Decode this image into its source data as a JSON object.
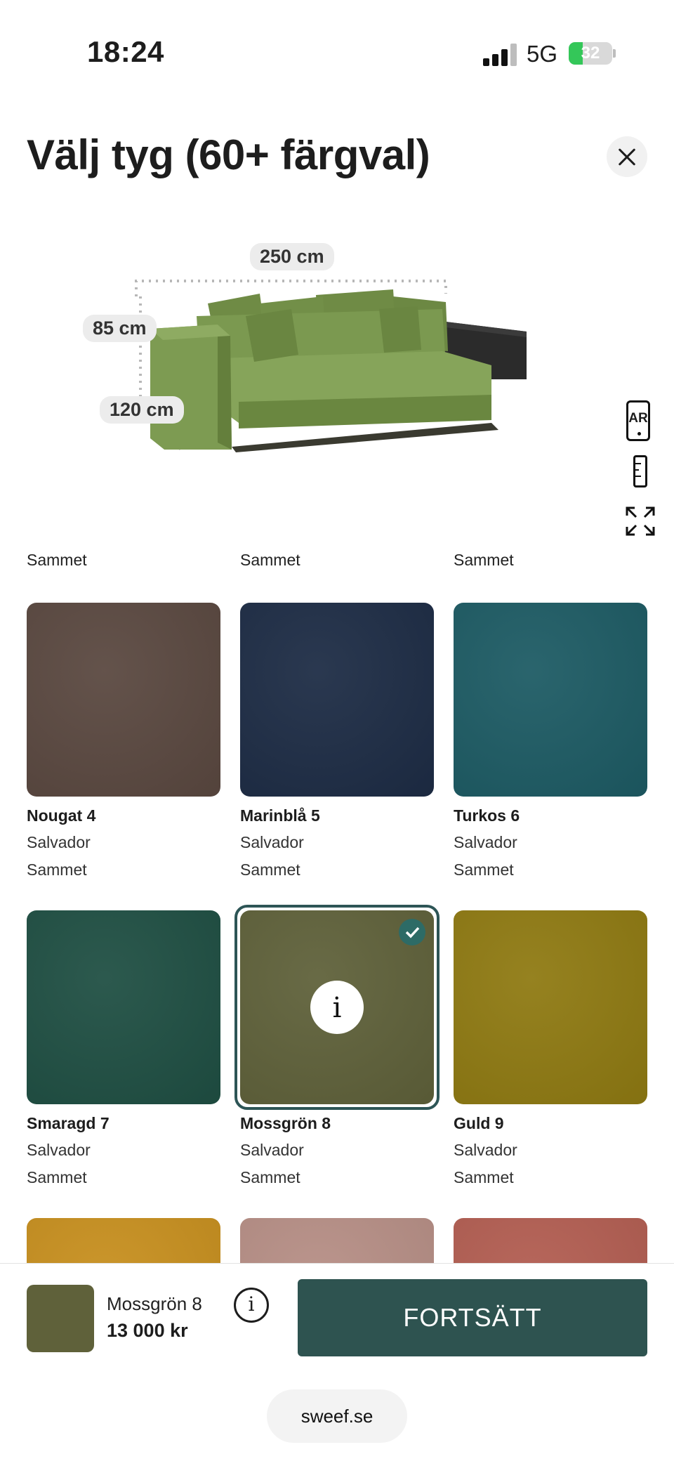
{
  "status": {
    "time": "18:24",
    "network": "5G",
    "battery_percent": "32",
    "battery_level": 0.32,
    "battery_color": "#34c759"
  },
  "header": {
    "title": "Välj tyg (60+ färgval)",
    "close_icon": "close-icon"
  },
  "preview": {
    "width_label": "250 cm",
    "height_label": "85 cm",
    "depth_label": "120 cm",
    "tools": [
      "ar-icon",
      "ruler-icon",
      "expand-icon"
    ],
    "ar_text": "AR",
    "sofa_color": "#7c9a4f"
  },
  "fabrics": {
    "top_row_labels": [
      "Sammet",
      "Sammet",
      "Sammet"
    ],
    "items": [
      {
        "name": "Nougat 4",
        "collection": "Salvador",
        "type": "Sammet",
        "color": "#5a4840",
        "selected": false
      },
      {
        "name": "Marinblå 5",
        "collection": "Salvador",
        "type": "Sammet",
        "color": "#1d2c45",
        "selected": false
      },
      {
        "name": "Turkos 6",
        "collection": "Salvador",
        "type": "Sammet",
        "color": "#1d5b64",
        "selected": false
      },
      {
        "name": "Smaragd 7",
        "collection": "Salvador",
        "type": "Sammet",
        "color": "#1f4f43",
        "selected": false
      },
      {
        "name": "Mossgrön 8",
        "collection": "Salvador",
        "type": "Sammet",
        "color": "#5f613a",
        "selected": true
      },
      {
        "name": "Guld 9",
        "collection": "Salvador",
        "type": "Sammet",
        "color": "#8f7a12",
        "selected": false
      },
      {
        "name": "",
        "collection": "",
        "type": "",
        "color": "#c8901f",
        "selected": false
      },
      {
        "name": "",
        "collection": "",
        "type": "",
        "color": "#b78f86",
        "selected": false
      },
      {
        "name": "",
        "collection": "",
        "type": "",
        "color": "#b35e52",
        "selected": false
      }
    ],
    "selected_icon": "check-icon",
    "info_icon": "info-icon",
    "info_glyph": "i"
  },
  "selection": {
    "name": "Mossgrön 8",
    "price": "13 000 kr",
    "color": "#5f613a",
    "info_glyph": "i",
    "continue_label": "FORTSÄTT",
    "continue_color": "#2e5350"
  },
  "browser": {
    "url": "sweef.se"
  }
}
